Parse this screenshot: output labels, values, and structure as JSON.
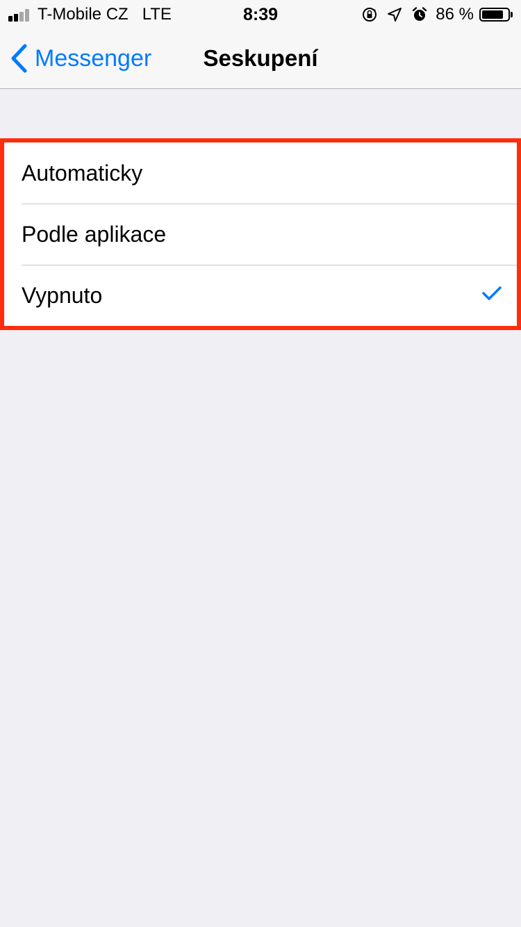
{
  "status_bar": {
    "carrier": "T-Mobile CZ",
    "network": "LTE",
    "time": "8:39",
    "battery_percent": "86 %",
    "battery_level": 0.86,
    "signal_bars": 2,
    "icons": [
      "orientation-lock-icon",
      "location-icon",
      "alarm-icon",
      "battery-icon"
    ]
  },
  "nav": {
    "back_label": "Messenger",
    "title": "Seskupení"
  },
  "options": [
    {
      "label": "Automaticky",
      "selected": false
    },
    {
      "label": "Podle aplikace",
      "selected": false
    },
    {
      "label": "Vypnuto",
      "selected": true
    }
  ],
  "colors": {
    "accent": "#007AFF",
    "highlight_border": "#FF2D0B",
    "background": "#EFEFF4"
  }
}
